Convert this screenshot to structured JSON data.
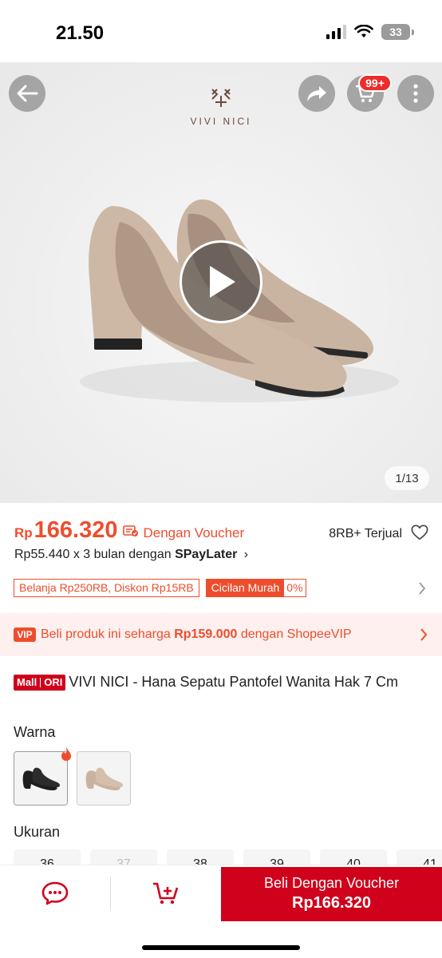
{
  "status_bar": {
    "time": "21.50",
    "battery": "33"
  },
  "hero": {
    "brand": "VIVI NICI",
    "cart_badge": "99+",
    "counter": "1/13"
  },
  "price": {
    "currency": "Rp",
    "value": "166.320",
    "voucher_label": "Dengan Voucher",
    "sold": "8RB+ Terjual",
    "paylater_prefix": "Rp55.440 x 3 bulan dengan ",
    "paylater_brand": "SPayLater",
    "paylater_chevron": "›"
  },
  "promos": {
    "discount_tag": "Belanja Rp250RB, Diskon Rp15RB",
    "cicilan_label": "Cicilan Murah",
    "cicilan_rate": "0%"
  },
  "vip": {
    "badge": "VIP",
    "text_prefix": "Beli produk ini seharga ",
    "price": "Rp159.000",
    "text_suffix": " dengan ShopeeVIP"
  },
  "product": {
    "mall_label": "Mall",
    "ori_label": "ORI",
    "title": "VIVI NICI - Hana Sepatu Pantofel Wanita Hak 7 Cm"
  },
  "variants": {
    "label": "Warna",
    "items": [
      {
        "name": "black",
        "color": "#1e1e1e"
      },
      {
        "name": "nude",
        "color": "#c9b39f"
      }
    ]
  },
  "sizes": {
    "label": "Ukuran",
    "items": [
      "36",
      "37",
      "38",
      "39",
      "40",
      "41"
    ],
    "disabled": [
      "37"
    ]
  },
  "bottom_bar": {
    "buy_label": "Beli Dengan Voucher",
    "buy_price": "Rp166.320"
  },
  "colors": {
    "accent": "#ee4d2d",
    "mall_red": "#d0011b",
    "vip_bg": "#fdf0ee"
  }
}
